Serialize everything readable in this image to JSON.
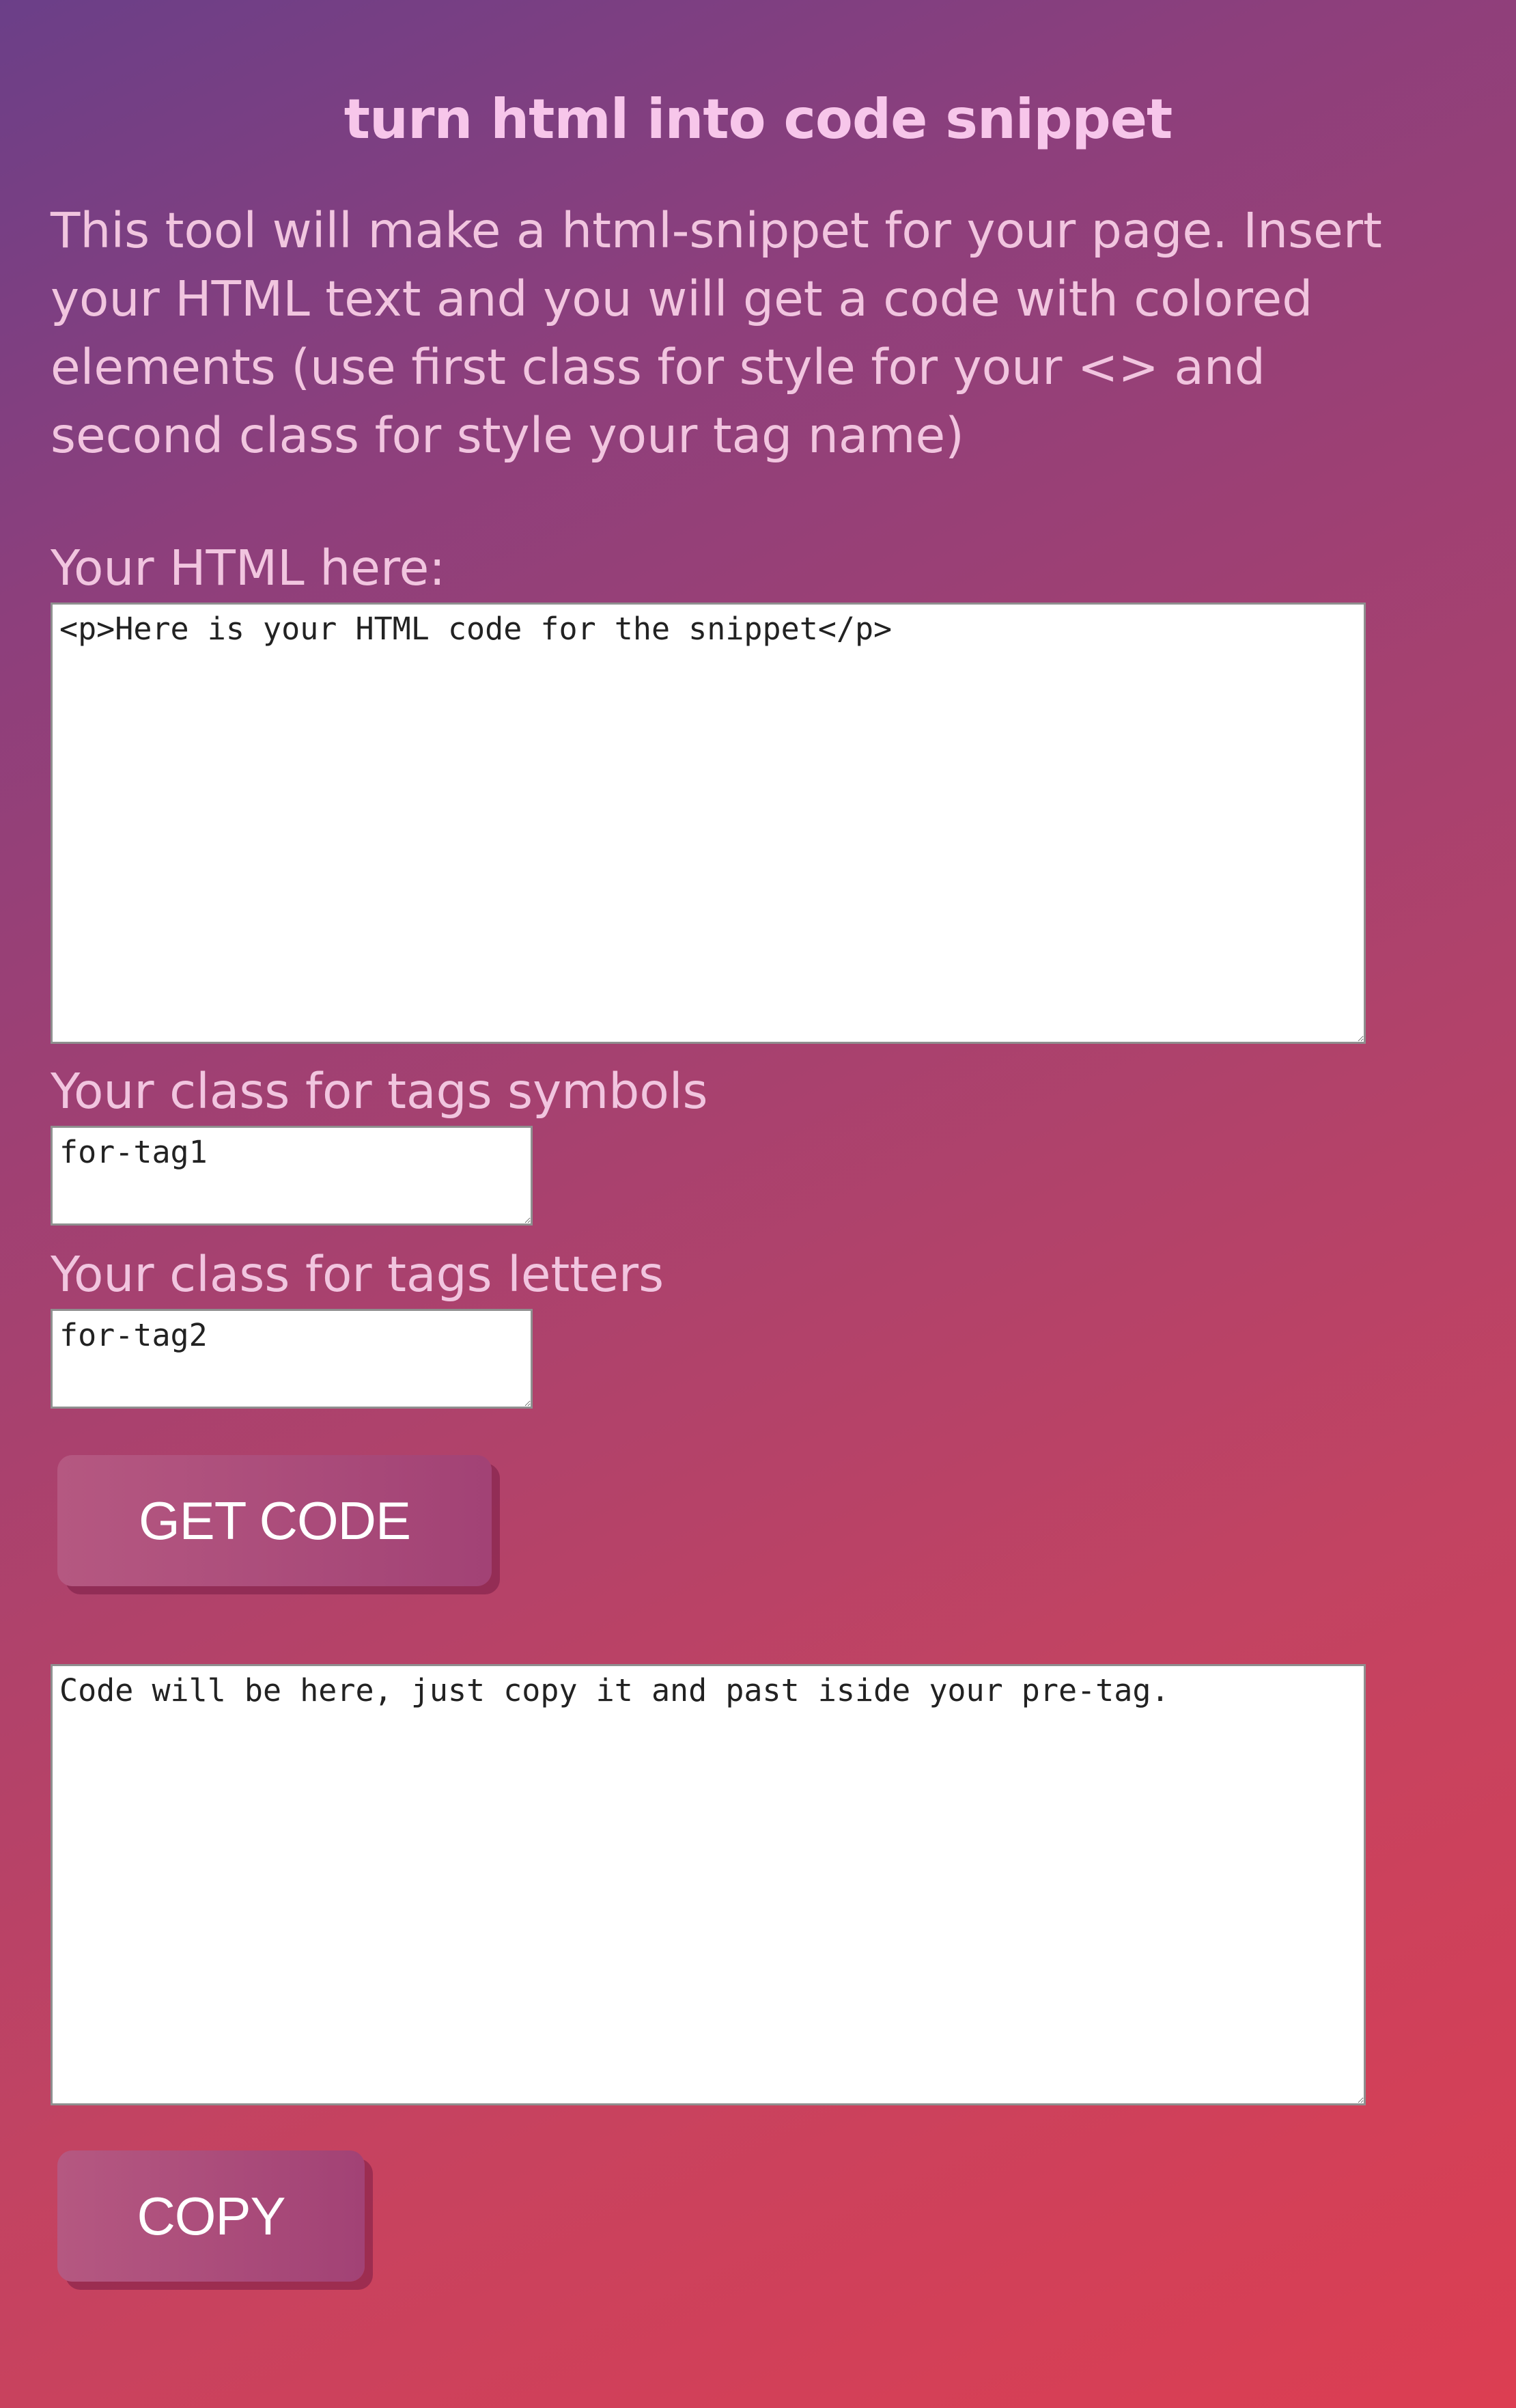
{
  "header": {
    "title": "turn html into code snippet"
  },
  "intro": {
    "text": "This tool will make a html-snippet for your page. Insert your HTML text and you will get a code with colored elements (use first class for style for your <> and second class for style your tag name)"
  },
  "html_input": {
    "label": "Your HTML here:",
    "value": "<p>Here is your HTML code for the snippet</p>"
  },
  "tag_symbols": {
    "label": "Your class for tags symbols",
    "value": "for-tag1"
  },
  "tag_letters": {
    "label": "Your class for tags letters",
    "value": "for-tag2"
  },
  "actions": {
    "get_code_label": "GET CODE",
    "copy_label": "COPY"
  },
  "output": {
    "value": "Code will be here, just copy it and past iside your pre-tag."
  },
  "colors": {
    "gradient_start": "#6b3f88",
    "gradient_end": "#dc3e52",
    "text": "#f1c5df",
    "button": "#b55881"
  }
}
